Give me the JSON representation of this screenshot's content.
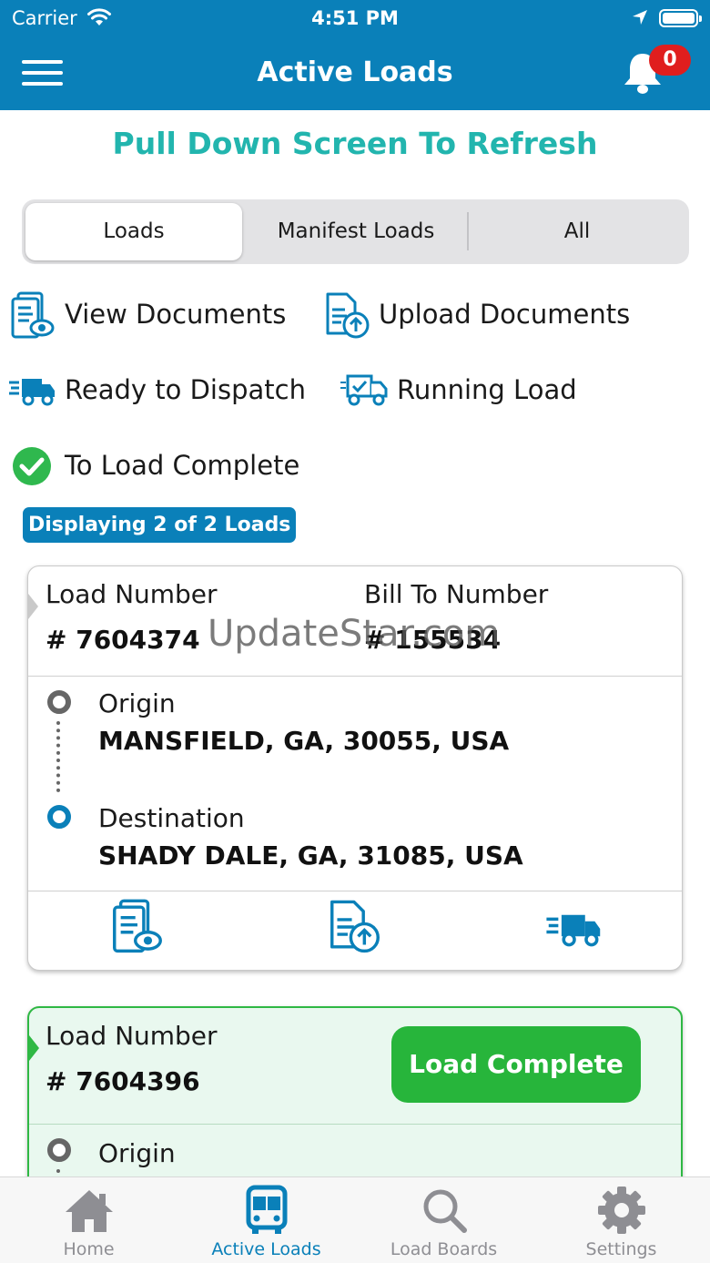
{
  "status_bar": {
    "carrier": "Carrier",
    "time": "4:51 PM"
  },
  "header": {
    "title": "Active Loads",
    "notification_count": "0"
  },
  "refresh_hint": "Pull Down Screen To Refresh",
  "segments": [
    {
      "label": "Loads",
      "selected": true
    },
    {
      "label": "Manifest Loads",
      "selected": false
    },
    {
      "label": "All",
      "selected": false
    }
  ],
  "legend": {
    "view_documents": "View Documents",
    "upload_documents": "Upload Documents",
    "ready_to_dispatch": "Ready to Dispatch",
    "running_load": "Running Load",
    "to_load_complete": "To Load Complete"
  },
  "displaying": "Displaying 2 of 2 Loads",
  "watermark": "UpdateStar.com",
  "loads": [
    {
      "load_number_label": "Load Number",
      "load_number": "# 7604374",
      "bill_to_label": "Bill To Number",
      "bill_to": "# 155534",
      "origin_label": "Origin",
      "origin": "MANSFIELD, GA, 30055, USA",
      "destination_label": "Destination",
      "destination": "SHADY DALE, GA, 31085, USA"
    },
    {
      "load_number_label": "Load Number",
      "load_number": "# 7604396",
      "action_label": "Load Complete",
      "origin_label": "Origin"
    }
  ],
  "tabs": [
    {
      "label": "Home",
      "icon": "home-icon",
      "active": false
    },
    {
      "label": "Active Loads",
      "icon": "bus-icon",
      "active": true
    },
    {
      "label": "Load Boards",
      "icon": "search-icon",
      "active": false
    },
    {
      "label": "Settings",
      "icon": "gear-icon",
      "active": false
    }
  ],
  "colors": {
    "brand_blue": "#0a80b9",
    "teal": "#22b5ae",
    "green": "#27b53b",
    "badge_red": "#e01e1e"
  }
}
